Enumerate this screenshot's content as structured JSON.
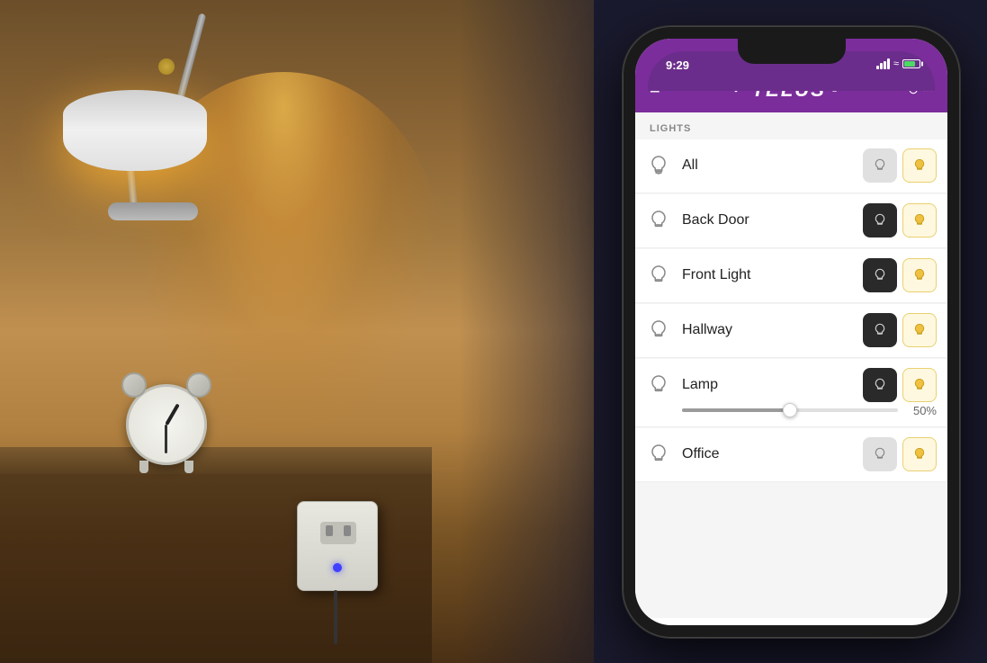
{
  "scene": {
    "background": "#1a1a2e"
  },
  "phone": {
    "status_bar": {
      "time": "9:29",
      "battery_level": "75"
    },
    "header": {
      "menu_icon": "≡",
      "logo": "TELUS",
      "logo_mark": "✦",
      "settings_icon": "⊙"
    },
    "app": {
      "section_label": "LIGHTS",
      "lights": [
        {
          "name": "All",
          "has_slider": false,
          "btn1_state": "gray",
          "btn2_state": "light-yellow"
        },
        {
          "name": "Back Door",
          "has_slider": false,
          "btn1_state": "dark",
          "btn2_state": "light-yellow"
        },
        {
          "name": "Front Light",
          "has_slider": false,
          "btn1_state": "dark",
          "btn2_state": "light-yellow"
        },
        {
          "name": "Hallway",
          "has_slider": false,
          "btn1_state": "dark",
          "btn2_state": "light-yellow"
        },
        {
          "name": "Lamp",
          "has_slider": true,
          "slider_value": 50,
          "slider_label": "50%",
          "btn1_state": "dark",
          "btn2_state": "light-yellow"
        },
        {
          "name": "Office",
          "has_slider": false,
          "btn1_state": "gray",
          "btn2_state": "light-yellow"
        }
      ]
    }
  }
}
